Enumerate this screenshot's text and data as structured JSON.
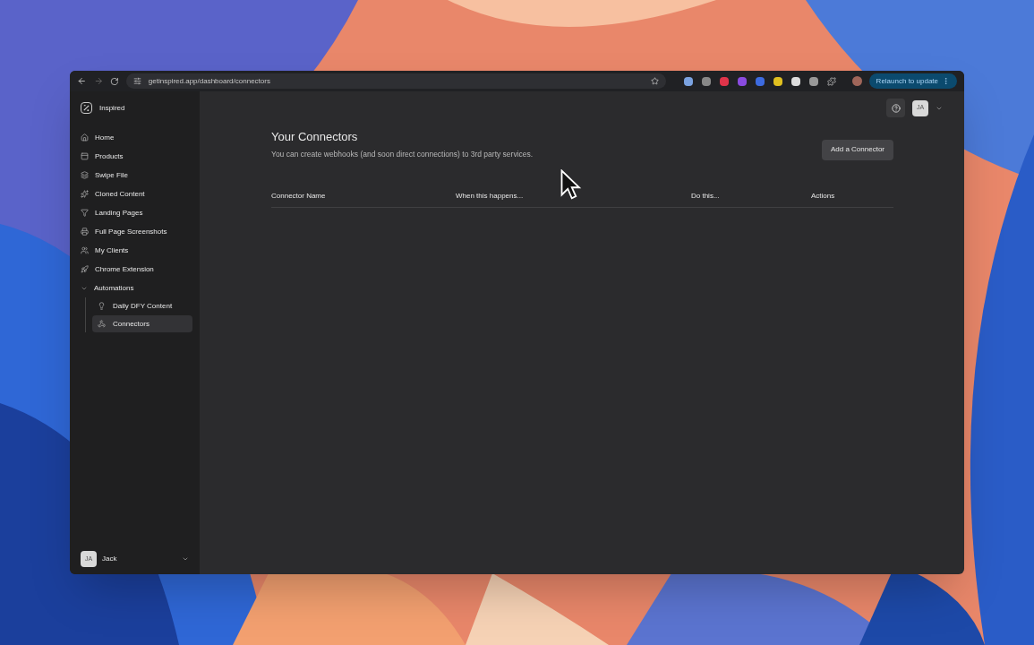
{
  "browser": {
    "url": "getinspired.app/dashboard/connectors",
    "relaunch_button": "Relaunch to update"
  },
  "sidebar": {
    "brand": "Inspired",
    "items": [
      {
        "label": "Home",
        "selected": false
      },
      {
        "label": "Products",
        "selected": false
      },
      {
        "label": "Swipe File",
        "selected": false
      },
      {
        "label": "Cloned Content",
        "selected": false
      },
      {
        "label": "Landing Pages",
        "selected": false
      },
      {
        "label": "Full Page Screenshots",
        "selected": false
      },
      {
        "label": "My Clients",
        "selected": false
      },
      {
        "label": "Chrome Extension",
        "selected": false
      },
      {
        "label": "Automations",
        "selected": false,
        "expanded": true,
        "children": [
          {
            "label": "Daily DFY Content",
            "selected": false
          },
          {
            "label": "Connectors",
            "selected": true
          }
        ]
      }
    ],
    "user": {
      "initials": "JA",
      "name": "Jack"
    }
  },
  "header": {
    "avatar_initials": "JA"
  },
  "page": {
    "title": "Your Connectors",
    "description": "You can create webhooks (and soon direct connections) to 3rd party services.",
    "add_button": "Add a Connector",
    "table": {
      "columns": [
        "Connector Name",
        "When this happens...",
        "Do this...",
        "Actions"
      ]
    }
  }
}
